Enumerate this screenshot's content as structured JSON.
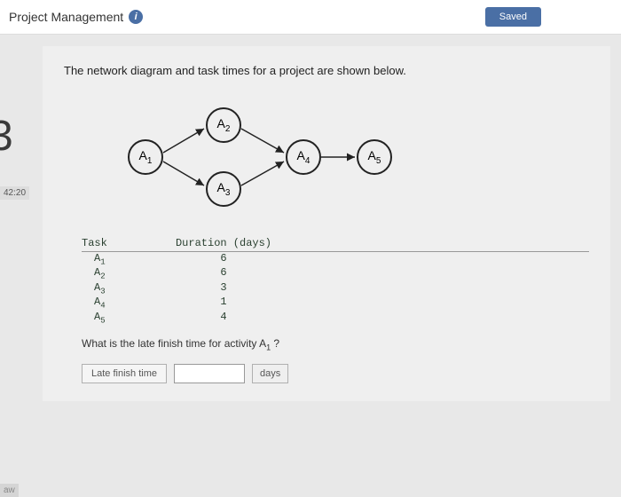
{
  "header": {
    "title": "Project Management",
    "saved": "Saved"
  },
  "left": {
    "partial_num": "3",
    "timer": "42:20",
    "aw": "aw"
  },
  "prompt": "The network diagram and task times for a project are shown below.",
  "nodes": {
    "n1": "A",
    "n1s": "1",
    "n2": "A",
    "n2s": "2",
    "n3": "A",
    "n3s": "3",
    "n4": "A",
    "n4s": "4",
    "n5": "A",
    "n5s": "5"
  },
  "table": {
    "h_task": "Task",
    "h_dur": "Duration (days)",
    "rows": [
      {
        "t": "A",
        "s": "1",
        "d": "6"
      },
      {
        "t": "A",
        "s": "2",
        "d": "6"
      },
      {
        "t": "A",
        "s": "3",
        "d": "3"
      },
      {
        "t": "A",
        "s": "4",
        "d": "1"
      },
      {
        "t": "A",
        "s": "5",
        "d": "4"
      }
    ]
  },
  "question": {
    "pre": "What is the late finish time for activity A",
    "sub": "1",
    "post": " ?"
  },
  "answer": {
    "label": "Late finish time",
    "unit": "days"
  }
}
